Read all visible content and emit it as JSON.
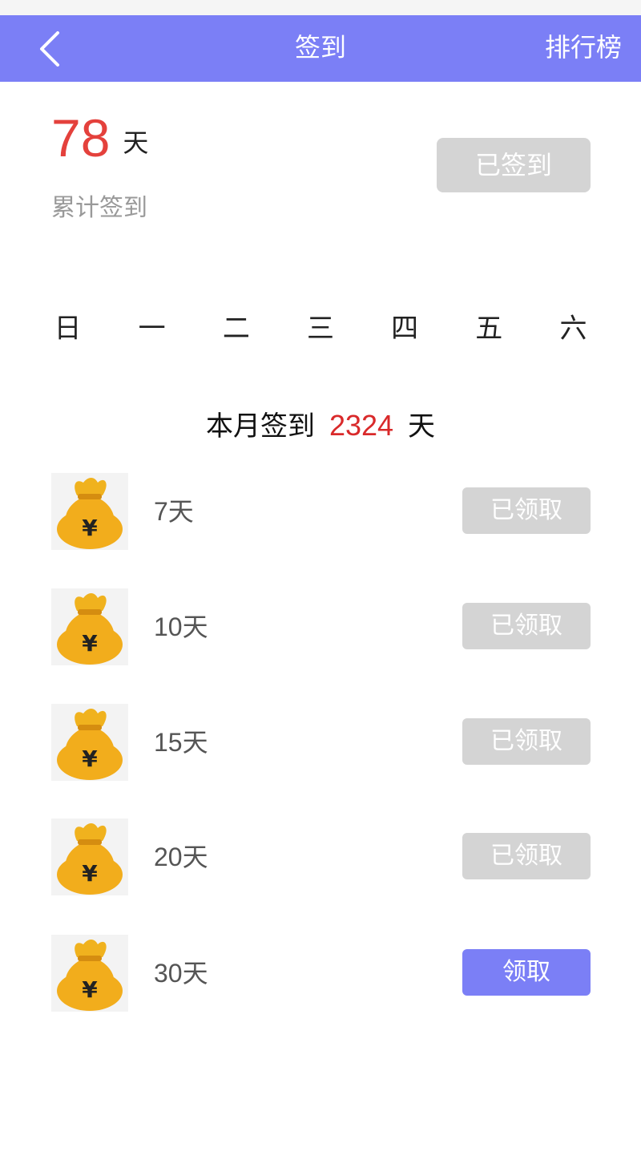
{
  "header": {
    "title": "签到",
    "ranking_label": "排行榜"
  },
  "summary": {
    "total_days": "78",
    "unit": "天",
    "label": "累计签到",
    "checkin_button": "已签到"
  },
  "weekdays": [
    "日",
    "一",
    "二",
    "三",
    "四",
    "五",
    "六"
  ],
  "month": {
    "prefix": "本月签到",
    "count": "2324",
    "suffix": "天"
  },
  "rewards": [
    {
      "days": "7天",
      "button": "已领取",
      "state": "claimed"
    },
    {
      "days": "10天",
      "button": "已领取",
      "state": "claimed"
    },
    {
      "days": "15天",
      "button": "已领取",
      "state": "claimed"
    },
    {
      "days": "20天",
      "button": "已领取",
      "state": "claimed"
    },
    {
      "days": "30天",
      "button": "领取",
      "state": "available"
    }
  ],
  "colors": {
    "accent": "#7b7ff6",
    "highlight_red": "#e4413c",
    "disabled_gray": "#d4d4d4"
  },
  "icons": {
    "back": "chevron-left-icon",
    "reward": "money-bag-icon"
  }
}
